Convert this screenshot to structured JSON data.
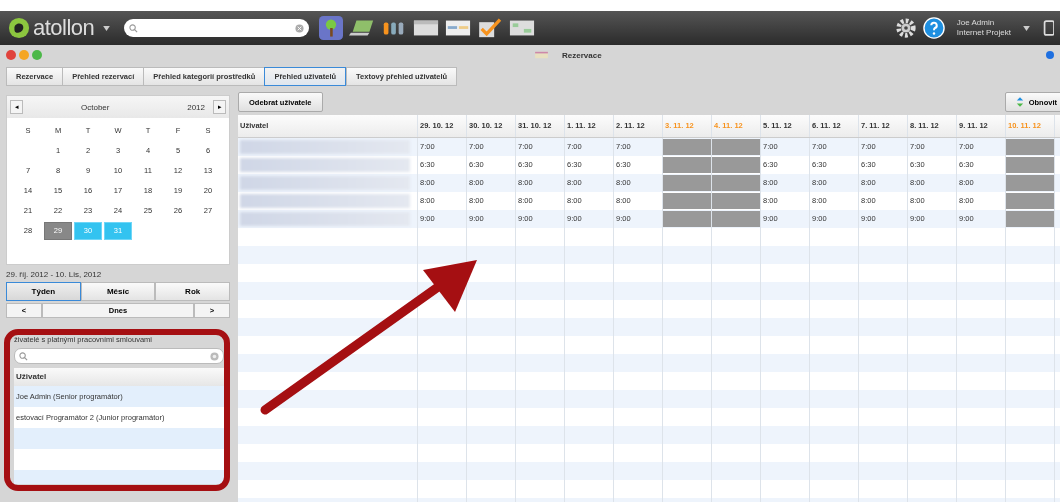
{
  "app_bar": {
    "logo": "atollon",
    "user": {
      "name": "Joe Admin",
      "company": "Internet Projekt"
    }
  },
  "window": {
    "title": "Rezervace"
  },
  "tabs": [
    {
      "label": "Rezervace",
      "selected": false
    },
    {
      "label": "Přehled rezervací",
      "selected": false
    },
    {
      "label": "Přehled kategorií prostředků",
      "selected": false
    },
    {
      "label": "Přehled uživatelů",
      "selected": true
    },
    {
      "label": "Textový přehled uživatelů",
      "selected": false
    }
  ],
  "calendar": {
    "prev": "◂",
    "month": "October",
    "year": "2012",
    "next": "▸",
    "weekdays": [
      "S",
      "M",
      "T",
      "W",
      "T",
      "F",
      "S"
    ],
    "weeks": [
      {
        "days": [
          {
            "label": "1",
            "selected": false,
            "in_range": false
          },
          {
            "label": "2",
            "selected": false,
            "in_range": false
          },
          {
            "label": "3",
            "selected": false,
            "in_range": false
          },
          {
            "label": "4",
            "selected": false,
            "in_range": false
          },
          {
            "label": "5",
            "selected": false,
            "in_range": false
          },
          {
            "label": "6",
            "selected": false,
            "in_range": false
          }
        ]
      },
      {
        "days": [
          {
            "label": "7",
            "selected": false,
            "in_range": false
          },
          {
            "label": "8",
            "selected": false,
            "in_range": false
          },
          {
            "label": "9",
            "selected": false,
            "in_range": false
          },
          {
            "label": "10",
            "selected": false,
            "in_range": false
          },
          {
            "label": "11",
            "selected": false,
            "in_range": false
          },
          {
            "label": "12",
            "selected": false,
            "in_range": false
          },
          {
            "label": "13",
            "selected": false,
            "in_range": false
          }
        ]
      },
      {
        "days": [
          {
            "label": "14",
            "selected": false,
            "in_range": false
          },
          {
            "label": "15",
            "selected": false,
            "in_range": false
          },
          {
            "label": "16",
            "selected": false,
            "in_range": false
          },
          {
            "label": "17",
            "selected": false,
            "in_range": false
          },
          {
            "label": "18",
            "selected": false,
            "in_range": false
          },
          {
            "label": "19",
            "selected": false,
            "in_range": false
          },
          {
            "label": "20",
            "selected": false,
            "in_range": false
          }
        ]
      },
      {
        "days": [
          {
            "label": "21",
            "selected": false,
            "in_range": false
          },
          {
            "label": "22",
            "selected": false,
            "in_range": false
          },
          {
            "label": "23",
            "selected": false,
            "in_range": false
          },
          {
            "label": "24",
            "selected": false,
            "in_range": false
          },
          {
            "label": "25",
            "selected": false,
            "in_range": false
          },
          {
            "label": "26",
            "selected": false,
            "in_range": false
          },
          {
            "label": "27",
            "selected": false,
            "in_range": false
          }
        ]
      },
      {
        "days": [
          {
            "label": "28",
            "selected": false,
            "in_range": false
          },
          {
            "label": "29",
            "selected": true,
            "in_range": true
          },
          {
            "label": "30",
            "selected": false,
            "in_range": true
          },
          {
            "label": "31",
            "selected": false,
            "in_range": true
          }
        ]
      }
    ]
  },
  "range_label": "29. říj. 2012 - 10. Lis, 2012",
  "period_buttons": [
    {
      "label": "Týden",
      "selected": true
    },
    {
      "label": "Měsíc",
      "selected": false
    },
    {
      "label": "Rok",
      "selected": false
    }
  ],
  "nav": {
    "prev": "<",
    "today": "Dnes",
    "next": ">"
  },
  "users_panel": {
    "title": "živatelé s platnými pracovními smlouvami",
    "column": "Uživatel",
    "rows": [
      "Joe Admin (Senior programátor)",
      "estovací Programátor 2 (Junior programátor)"
    ]
  },
  "schedule": {
    "remove_button": "Odebrat uživatele",
    "refresh_button": "Obnovit",
    "name_column": "Uživatel",
    "columns": [
      {
        "label": "29. 10. 12",
        "weekend": false
      },
      {
        "label": "30. 10. 12",
        "weekend": false
      },
      {
        "label": "31. 10. 12",
        "weekend": false
      },
      {
        "label": "1. 11. 12",
        "weekend": false
      },
      {
        "label": "2. 11. 12",
        "weekend": false
      },
      {
        "label": "3. 11. 12",
        "weekend": true
      },
      {
        "label": "4. 11. 12",
        "weekend": true
      },
      {
        "label": "5. 11. 12",
        "weekend": false
      },
      {
        "label": "6. 11. 12",
        "weekend": false
      },
      {
        "label": "7. 11. 12",
        "weekend": false
      },
      {
        "label": "8. 11. 12",
        "weekend": false
      },
      {
        "label": "9. 11. 12",
        "weekend": false
      },
      {
        "label": "10. 11. 12",
        "weekend": true
      }
    ],
    "rows": [
      {
        "cells": [
          "7:00",
          "7:00",
          "7:00",
          "7:00",
          "7:00",
          null,
          null,
          "7:00",
          "7:00",
          "7:00",
          "7:00",
          "7:00",
          null
        ]
      },
      {
        "cells": [
          "6:30",
          "6:30",
          "6:30",
          "6:30",
          "6:30",
          null,
          null,
          "6:30",
          "6:30",
          "6:30",
          "6:30",
          "6:30",
          null
        ]
      },
      {
        "cells": [
          "8:00",
          "8:00",
          "8:00",
          "8:00",
          "8:00",
          null,
          null,
          "8:00",
          "8:00",
          "8:00",
          "8:00",
          "8:00",
          null
        ]
      },
      {
        "cells": [
          "8:00",
          "8:00",
          "8:00",
          "8:00",
          "8:00",
          null,
          null,
          "8:00",
          "8:00",
          "8:00",
          "8:00",
          "8:00",
          null
        ]
      },
      {
        "cells": [
          "9:00",
          "9:00",
          "9:00",
          "9:00",
          "9:00",
          null,
          null,
          "9:00",
          "9:00",
          "9:00",
          "9:00",
          "9:00",
          null
        ]
      }
    ]
  }
}
